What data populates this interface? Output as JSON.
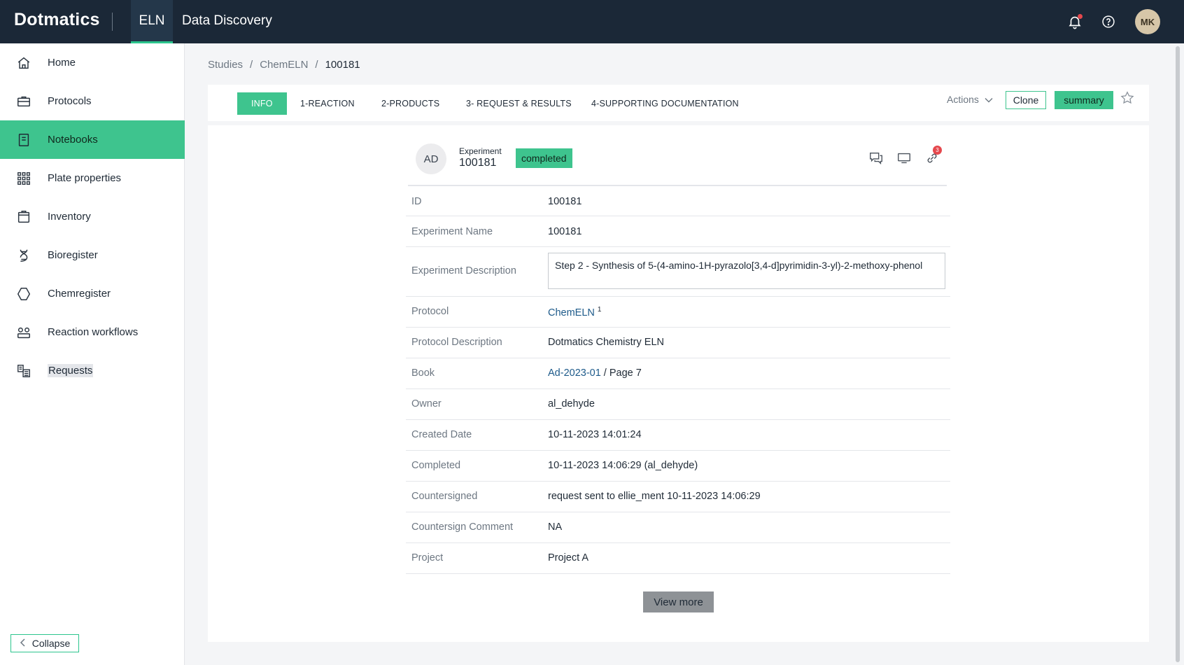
{
  "topbar": {
    "logo": "Dotmatics",
    "eln_tab": "ELN",
    "data_discovery": "Data Discovery",
    "user_initials": "MK"
  },
  "sidebar": {
    "items": [
      {
        "label": "Home",
        "icon": "home-icon"
      },
      {
        "label": "Protocols",
        "icon": "briefcase-icon"
      },
      {
        "label": "Notebooks",
        "icon": "notebook-icon"
      },
      {
        "label": "Plate properties",
        "icon": "grid-icon"
      },
      {
        "label": "Inventory",
        "icon": "box-icon"
      },
      {
        "label": "Bioregister",
        "icon": "dna-icon"
      },
      {
        "label": "Chemregister",
        "icon": "hexagon-icon"
      },
      {
        "label": "Reaction workflows",
        "icon": "workflow-icon"
      },
      {
        "label": "Requests",
        "icon": "requests-icon"
      }
    ],
    "active_item": "Notebooks",
    "collapse_label": "Collapse"
  },
  "breadcrumb": {
    "items": [
      "Studies",
      "ChemELN",
      "100181"
    ],
    "separator": "/"
  },
  "tabs": {
    "items": [
      "INFO",
      "1-REACTION",
      "2-PRODUCTS",
      "3- REQUEST & RESULTS",
      "4-SUPPORTING DOCUMENTATION"
    ],
    "active": "INFO",
    "actions_label": "Actions",
    "clone_label": "Clone",
    "summary_label": "summary"
  },
  "experiment": {
    "avatar_initials": "AD",
    "label": "Experiment",
    "id": "100181",
    "status": "completed",
    "link_badge_count": "3"
  },
  "details": {
    "id": {
      "label": "ID",
      "value": "100181"
    },
    "name": {
      "label": "Experiment Name",
      "value": "100181"
    },
    "description": {
      "label": "Experiment Description",
      "value": "Step 2 - Synthesis of 5-(4-amino-1H-pyrazolo[3,4-d]pyrimidin-3-yl)-2-methoxy-phenol"
    },
    "protocol": {
      "label": "Protocol",
      "value": "ChemELN",
      "sup": "1"
    },
    "protocol_description": {
      "label": "Protocol Description",
      "value": "Dotmatics Chemistry ELN"
    },
    "book": {
      "label": "Book",
      "link": "Ad-2023-01",
      "page": " / Page 7"
    },
    "owner": {
      "label": "Owner",
      "value": "al_dehyde"
    },
    "created_date": {
      "label": "Created Date",
      "value": "10-11-2023 14:01:24"
    },
    "completed": {
      "label": "Completed",
      "value": "10-11-2023 14:06:29 (al_dehyde)"
    },
    "countersigned": {
      "label": "Countersigned",
      "prefix": "request sent to ",
      "user": "ellie_ment",
      "suffix": " 10-11-2023 14:06:29"
    },
    "countersign_comment": {
      "label": "Countersign Comment",
      "value": "NA"
    },
    "project": {
      "label": "Project",
      "value": "Project A"
    }
  },
  "view_more_label": "View more",
  "colors": {
    "topbar": "#1b2837",
    "accent": "#3ec48e",
    "link": "#1d5a8a",
    "notification_dot": "#e5484d"
  }
}
